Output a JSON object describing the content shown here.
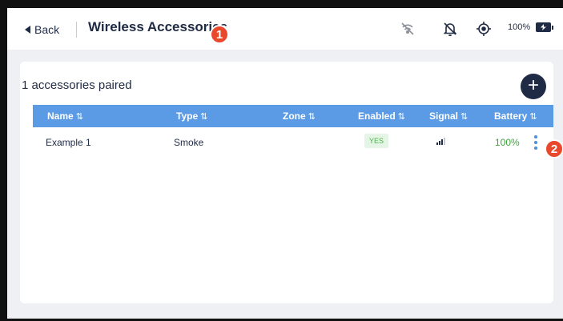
{
  "header": {
    "back_label": "Back",
    "title": "Wireless Accessories",
    "battery_percent": "100%",
    "icons": [
      "no-signal-icon",
      "bell-off-icon",
      "locate-icon",
      "battery-charging-icon"
    ]
  },
  "markers": {
    "m1": "1",
    "m2": "2"
  },
  "card": {
    "paired_text": "1 accessories paired",
    "add_label": "+"
  },
  "table": {
    "columns": [
      "Name",
      "Type",
      "Zone",
      "Enabled",
      "Signal",
      "Battery"
    ],
    "sort_glyph": "⇅",
    "rows": [
      {
        "name": "Example 1",
        "type": "Smoke",
        "zone": "",
        "enabled": "YES",
        "signal_bars": 3,
        "battery": "100%"
      }
    ]
  },
  "colors": {
    "header_row": "#5b9be5",
    "brand": "#1f2a44",
    "ok": "#3ba53b",
    "marker": "#e8482b"
  }
}
